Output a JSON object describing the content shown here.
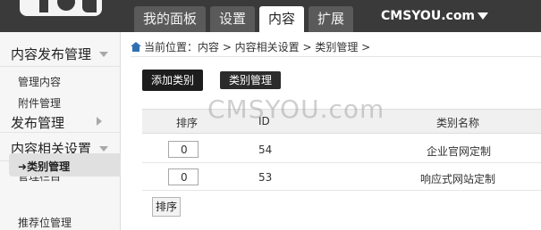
{
  "colors": {
    "topbar": "#3a3a3a",
    "tab": "#5a5a5a",
    "active_tab": "#ffffff",
    "accent_home": "#2f6fb1"
  },
  "header": {
    "tabs": [
      {
        "label": "我的面板"
      },
      {
        "label": "设置"
      },
      {
        "label": "内容",
        "active": true
      },
      {
        "label": "扩展"
      }
    ],
    "site_name": "CMSYOU.com"
  },
  "sidebar": {
    "sections": [
      {
        "title": "内容发布管理",
        "icon": "chevron-down-icon"
      },
      {
        "title": "发布管理",
        "icon": "chevron-right-icon"
      },
      {
        "title": "内容相关设置",
        "icon": "chevron-down-icon"
      }
    ],
    "items": [
      {
        "label": "管理内容"
      },
      {
        "label": "附件管理"
      },
      {
        "label": "管理栏目"
      },
      {
        "label": "类别管理",
        "active": true
      },
      {
        "label": "推荐位管理"
      }
    ]
  },
  "breadcrumb": {
    "text": "当前位置：内容 > 内容相关设置 > 类别管理 >",
    "icon": "home-icon"
  },
  "toolbar": {
    "add_label": "添加类别",
    "manage_label": "类别管理"
  },
  "table": {
    "headers": [
      "排序",
      "ID",
      "类别名称"
    ],
    "rows": [
      {
        "order": "0",
        "id": "54",
        "name": "企业官网定制"
      },
      {
        "order": "0",
        "id": "53",
        "name": "响应式网站定制"
      }
    ],
    "sort_button": "排序"
  },
  "watermark": "CMSYOU.com"
}
